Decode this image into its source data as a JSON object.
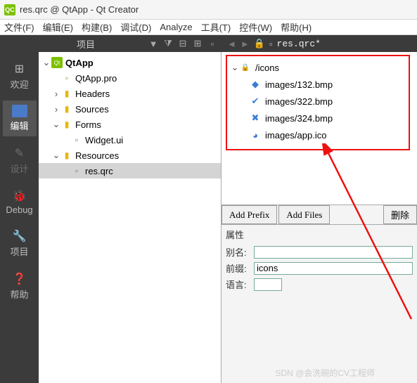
{
  "window": {
    "title": "res.qrc @ QtApp - Qt Creator"
  },
  "menu": {
    "file": "文件(F)",
    "edit": "编辑(E)",
    "build": "构建(B)",
    "debug": "调试(D)",
    "analyze": "Analyze",
    "tools": "工具(T)",
    "widgets": "控件(W)",
    "help": "帮助(H)"
  },
  "toolbar": {
    "project_label": "项目",
    "doc_name": "res.qrc*"
  },
  "sidebar": {
    "welcome": "欢迎",
    "edit": "编辑",
    "design": "设计",
    "debug": "Debug",
    "project": "项目",
    "help": "帮助"
  },
  "tree": {
    "root": "QtApp",
    "pro": "QtApp.pro",
    "headers": "Headers",
    "sources": "Sources",
    "forms": "Forms",
    "widget_ui": "Widget.ui",
    "resources": "Resources",
    "res_qrc": "res.qrc"
  },
  "resources": {
    "prefix": "/icons",
    "items": [
      "images/132.bmp",
      "images/322.bmp",
      "images/324.bmp",
      "images/app.ico"
    ]
  },
  "buttons": {
    "add_prefix": "Add Prefix",
    "add_files": "Add Files",
    "delete": "删除"
  },
  "props": {
    "title": "属性",
    "alias_label": "别名:",
    "alias_value": "",
    "prefix_label": "前缀:",
    "prefix_value": "icons",
    "lang_label": "语言:"
  },
  "watermark": "SDN @会洗碗的CV工程师"
}
